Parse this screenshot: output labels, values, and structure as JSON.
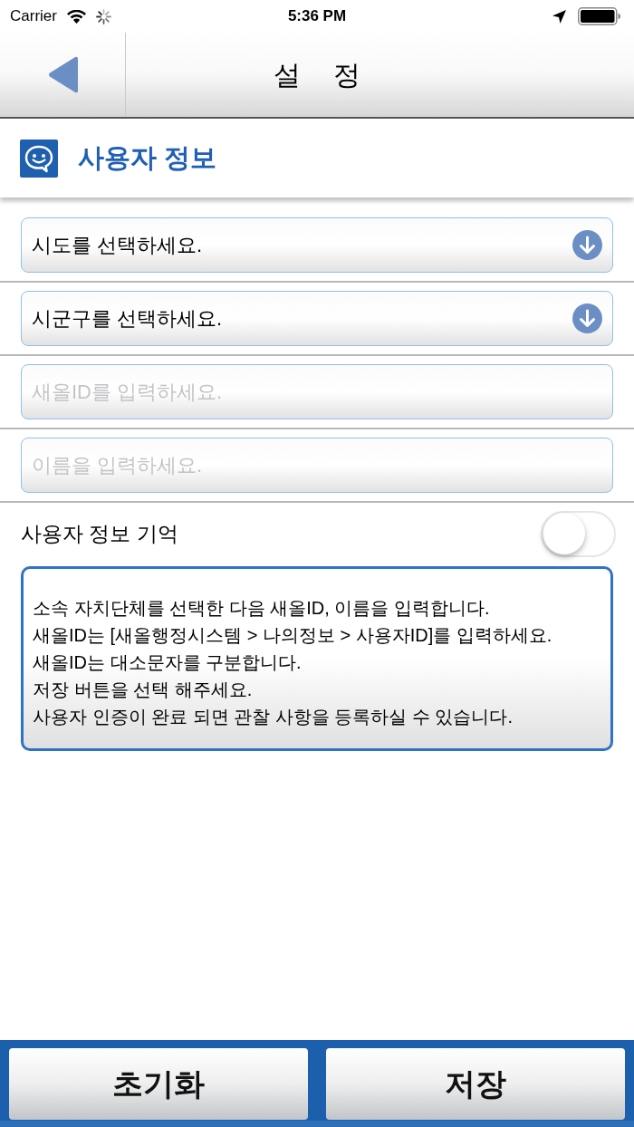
{
  "status_bar": {
    "carrier": "Carrier",
    "time": "5:36 PM"
  },
  "nav_bar": {
    "title": "설 정"
  },
  "section": {
    "title": "사용자 정보"
  },
  "fields": [
    {
      "kind": "select",
      "value": "시도를 선택하세요."
    },
    {
      "kind": "select",
      "value": "시군구를 선택하세요."
    },
    {
      "kind": "text",
      "placeholder": "새올ID를 입력하세요."
    },
    {
      "kind": "text",
      "placeholder": "이름을 입력하세요."
    }
  ],
  "remember": {
    "label": "사용자 정보 기억",
    "on": false
  },
  "info": {
    "lines": [
      "소속 자치단체를 선택한 다음 새올ID, 이름을 입력합니다.",
      "새올ID는 [새올행정시스템 > 나의정보 > 사용자ID]를 입력하세요.",
      "새올ID는 대소문자를 구분합니다.",
      "저장 버튼을 선택 해주세요.",
      "사용자 인증이 완료 되면 관찰 사항을 등록하실 수 있습니다."
    ]
  },
  "buttons": [
    "초기화",
    "저장"
  ]
}
